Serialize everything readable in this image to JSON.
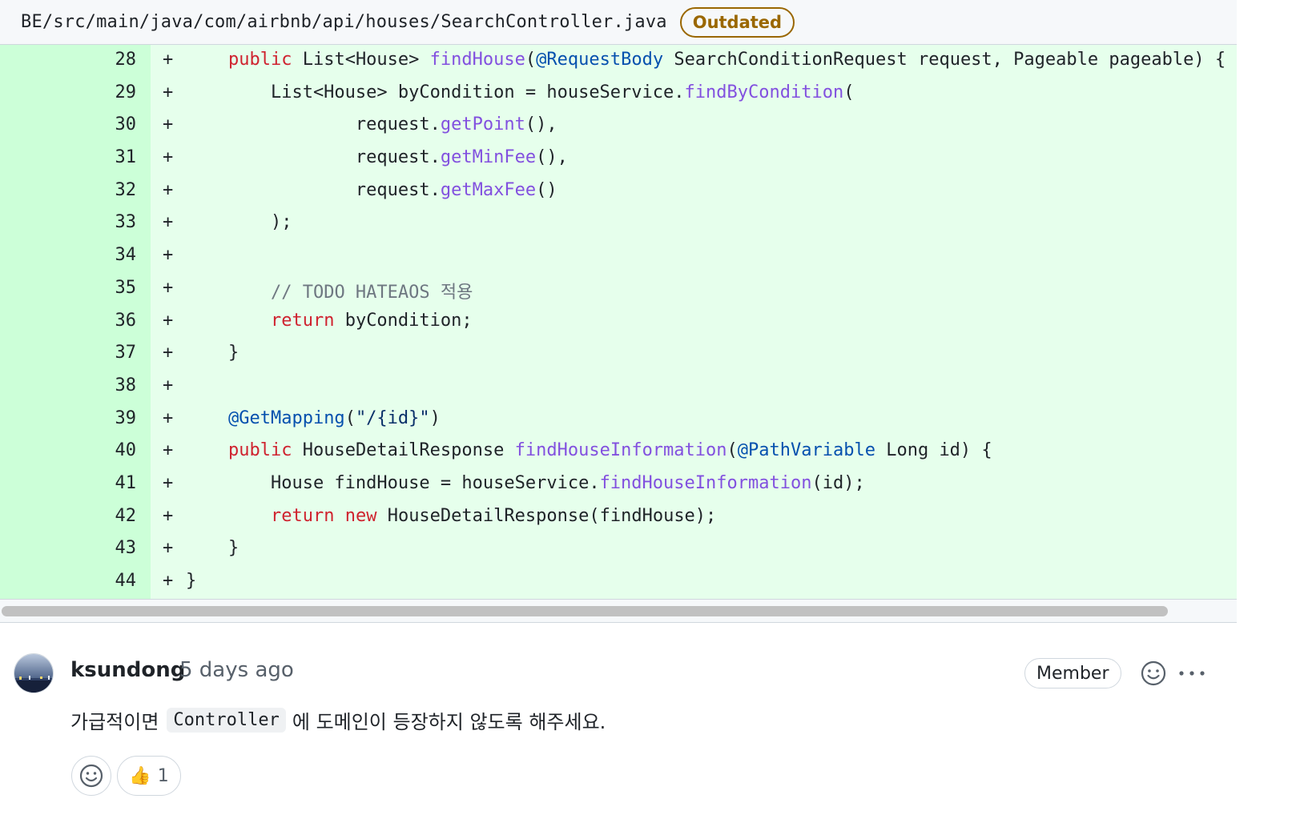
{
  "file_header": {
    "path": "BE/src/main/java/com/airbnb/api/houses/SearchController.java",
    "status_badge": "Outdated"
  },
  "diff": {
    "marker": "+",
    "lines": [
      {
        "num": "28",
        "tokens": [
          {
            "t": "    "
          },
          {
            "t": "public",
            "c": "kw"
          },
          {
            "t": " List<House> "
          },
          {
            "t": "findHouse",
            "c": "fn"
          },
          {
            "t": "("
          },
          {
            "t": "@RequestBody",
            "c": "an"
          },
          {
            "t": " SearchConditionRequest request, Pageable pageable) {"
          }
        ]
      },
      {
        "num": "29",
        "tokens": [
          {
            "t": "        List<House> byCondition = houseService."
          },
          {
            "t": "findByCondition",
            "c": "fn"
          },
          {
            "t": "("
          }
        ]
      },
      {
        "num": "30",
        "tokens": [
          {
            "t": "                request."
          },
          {
            "t": "getPoint",
            "c": "fn"
          },
          {
            "t": "(),"
          }
        ]
      },
      {
        "num": "31",
        "tokens": [
          {
            "t": "                request."
          },
          {
            "t": "getMinFee",
            "c": "fn"
          },
          {
            "t": "(),"
          }
        ]
      },
      {
        "num": "32",
        "tokens": [
          {
            "t": "                request."
          },
          {
            "t": "getMaxFee",
            "c": "fn"
          },
          {
            "t": "()"
          }
        ]
      },
      {
        "num": "33",
        "tokens": [
          {
            "t": "        );"
          }
        ]
      },
      {
        "num": "34",
        "tokens": [
          {
            "t": ""
          }
        ]
      },
      {
        "num": "35",
        "tokens": [
          {
            "t": "        "
          },
          {
            "t": "// TODO HATEAOS 적용",
            "c": "cm"
          }
        ]
      },
      {
        "num": "36",
        "tokens": [
          {
            "t": "        "
          },
          {
            "t": "return",
            "c": "kw"
          },
          {
            "t": " byCondition;"
          }
        ]
      },
      {
        "num": "37",
        "tokens": [
          {
            "t": "    }"
          }
        ]
      },
      {
        "num": "38",
        "tokens": [
          {
            "t": ""
          }
        ]
      },
      {
        "num": "39",
        "tokens": [
          {
            "t": "    "
          },
          {
            "t": "@GetMapping",
            "c": "an"
          },
          {
            "t": "("
          },
          {
            "t": "\"/{id}\"",
            "c": "str"
          },
          {
            "t": ")"
          }
        ]
      },
      {
        "num": "40",
        "tokens": [
          {
            "t": "    "
          },
          {
            "t": "public",
            "c": "kw"
          },
          {
            "t": " HouseDetailResponse "
          },
          {
            "t": "findHouseInformation",
            "c": "fn"
          },
          {
            "t": "("
          },
          {
            "t": "@PathVariable",
            "c": "an"
          },
          {
            "t": " Long id) {"
          }
        ]
      },
      {
        "num": "41",
        "tokens": [
          {
            "t": "        House findHouse = houseService."
          },
          {
            "t": "findHouseInformation",
            "c": "fn"
          },
          {
            "t": "(id);"
          }
        ]
      },
      {
        "num": "42",
        "tokens": [
          {
            "t": "        "
          },
          {
            "t": "return",
            "c": "kw"
          },
          {
            "t": " "
          },
          {
            "t": "new",
            "c": "kw"
          },
          {
            "t": " HouseDetailResponse(findHouse);"
          }
        ]
      },
      {
        "num": "43",
        "tokens": [
          {
            "t": "    }"
          }
        ]
      },
      {
        "num": "44",
        "tokens": [
          {
            "t": "}"
          }
        ]
      }
    ]
  },
  "comment": {
    "author": "ksundong",
    "time": "5 days ago",
    "role_badge": "Member",
    "body_before": "가급적이면",
    "body_code": "Controller",
    "body_after": "에 도메인이 등장하지 않도록 해주세요.",
    "reactions": [
      {
        "icon": "thumbs-up-icon",
        "emoji": "👍",
        "count": "1"
      }
    ]
  },
  "colors": {
    "added_gutter": "#ccffd8",
    "added_line": "#e6ffec",
    "keyword": "#cf222e",
    "function": "#8250df",
    "annotation": "#0550ae",
    "string": "#0a3069",
    "comment": "#6e7781",
    "outdated": "#9a6700"
  }
}
